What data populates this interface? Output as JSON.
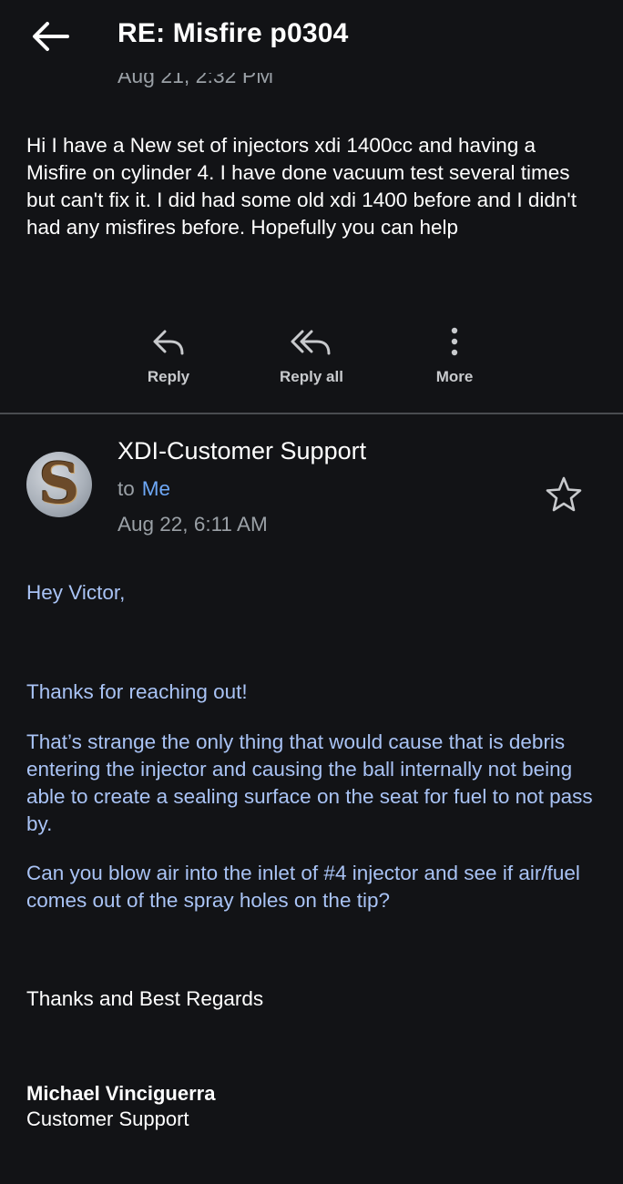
{
  "header": {
    "back_icon": "arrow-left-icon",
    "subject": "RE: Misfire p0304"
  },
  "previous_message": {
    "date": "Aug 21, 2:32 PM",
    "body": "Hi I have a New set of injectors xdi 1400cc and having a Misfire on cylinder 4. I have done vacuum test several times but can't fix it. I did had some old xdi 1400 before and I didn't had any misfires before. Hopefully you can help"
  },
  "actions": [
    {
      "label": "Reply",
      "icon": "reply-icon"
    },
    {
      "label": "Reply all",
      "icon": "reply-all-icon"
    },
    {
      "label": "More",
      "icon": "more-vertical-icon"
    }
  ],
  "message": {
    "avatar_letter": "S",
    "sender": "XDI-Customer Support",
    "to_prefix": "to",
    "to": "Me",
    "date": "Aug 22, 6:11 AM",
    "star_icon": "star-outline-icon",
    "greeting": "Hey Victor,",
    "paragraphs": [
      "Thanks for reaching out!",
      "That’s strange the only thing that would cause that is debris entering the injector and causing the ball internally not being able to create a sealing surface on the seat for fuel to not pass by.",
      "Can you blow air into the inlet of #4 injector and see if air/fuel comes out of the spray holes on the tip?"
    ],
    "closing": "Thanks and Best Regards",
    "signature_name": "Michael Vinciguerra",
    "signature_title": "Customer Support"
  },
  "colors": {
    "background": "#121316",
    "body_text_blue": "#a9c3f5",
    "link_blue": "#6ea8f7",
    "secondary_text": "#9aa0a6",
    "divider": "#4a4c50"
  }
}
